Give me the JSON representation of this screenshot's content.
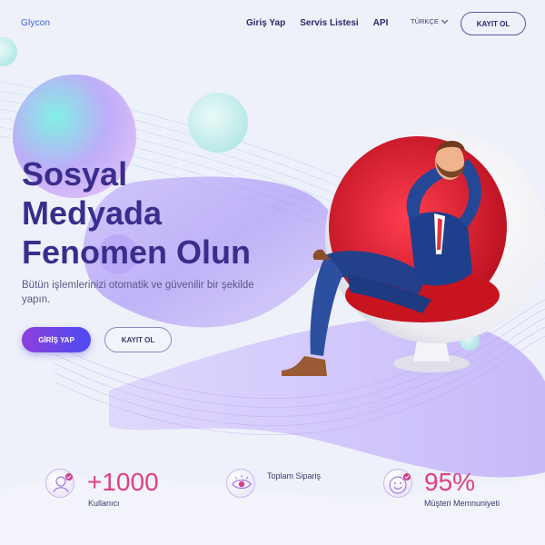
{
  "header": {
    "logo": "Glycon",
    "nav": [
      {
        "label": "Giriş Yap"
      },
      {
        "label": "Servis Listesi"
      },
      {
        "label": "API"
      }
    ],
    "language": "TÜRKÇE",
    "register_label": "KAYIT OL"
  },
  "hero": {
    "title_lines": [
      "Sosyal",
      "Medyada",
      "Fenomen Olun"
    ],
    "subtitle": "Bütün işlemlerinizi otomatik ve güvenilir bir şekilde yapın.",
    "login_label": "GİRİŞ YAP",
    "register_label": "KAYIT OL"
  },
  "stats": [
    {
      "value": "+1000",
      "label": "Kullanıcı",
      "icon": "user-check-icon"
    },
    {
      "value": "",
      "label": "Toplam Sipariş",
      "icon": "eye-icon"
    },
    {
      "value": "95%",
      "label": "Müşteri Memnuniyeti",
      "icon": "smile-check-icon"
    }
  ],
  "colors": {
    "background": "#eef1fa",
    "primary_text": "#3a2e8c",
    "accent_gradient_start": "#8e3fdc",
    "accent_gradient_end": "#4d4bf0",
    "stat_value": "#e0407e",
    "chair_red": "#d8182e"
  }
}
